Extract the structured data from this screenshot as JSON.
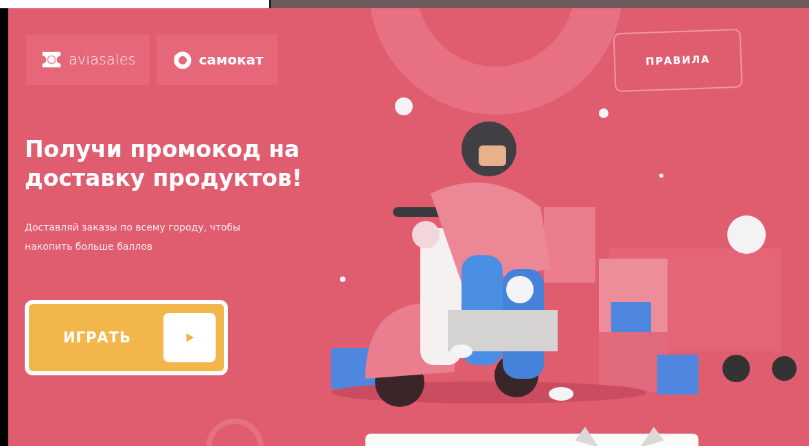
{
  "partners": [
    {
      "kind": "aviasales",
      "name": "aviasales"
    },
    {
      "kind": "samokat",
      "name": "самокат"
    }
  ],
  "rules_button": "ПРАВИЛА",
  "headline": "Получи промокод на доставку продуктов!",
  "subtitle": "Доставляй заказы по всему городу, чтобы накопить больше баллов",
  "play_button": "ИГРАТЬ"
}
